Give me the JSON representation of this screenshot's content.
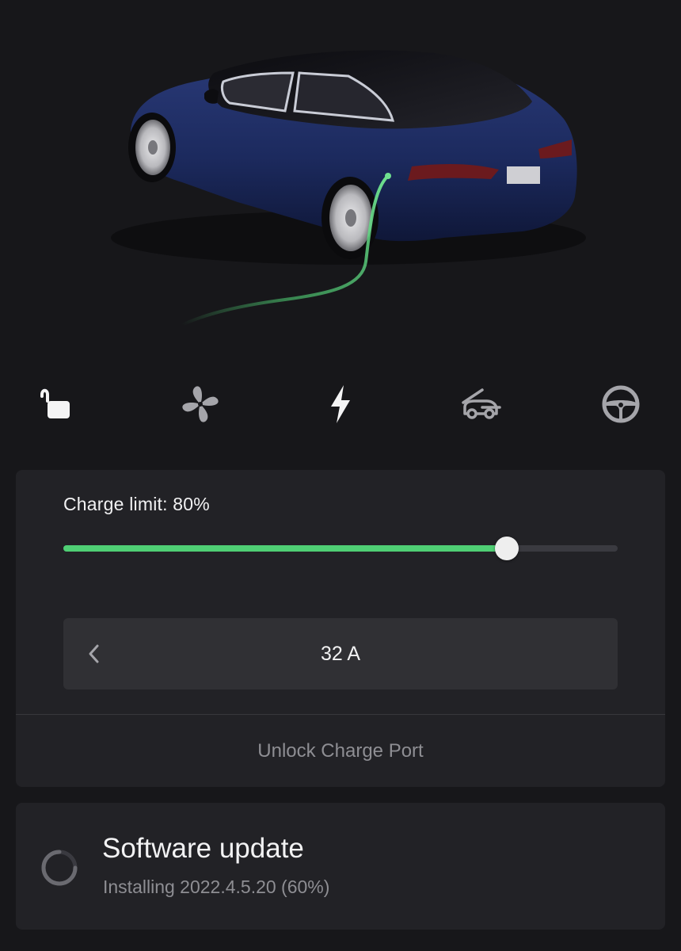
{
  "vehicle": {
    "image": "vehicle-charging-illustration",
    "paint_color": "#1c2a5e",
    "cable_color": "#4fcf74"
  },
  "quick_controls": [
    {
      "icon": "unlock-icon",
      "label": "Lock"
    },
    {
      "icon": "fan-icon",
      "label": "Climate"
    },
    {
      "icon": "bolt-icon",
      "label": "Charging",
      "active": true
    },
    {
      "icon": "car-frunk-icon",
      "label": "Controls"
    },
    {
      "icon": "steering-wheel-icon",
      "label": "Summon"
    }
  ],
  "charging": {
    "charge_limit_label": "Charge limit: 80%",
    "charge_limit_value": 80,
    "accent_color": "#4fcf74",
    "current_value": "32 A",
    "unlock_port_label": "Unlock Charge Port"
  },
  "software_update": {
    "title": "Software update",
    "status": "Installing 2022.4.5.20 (60%)",
    "progress": 60
  }
}
